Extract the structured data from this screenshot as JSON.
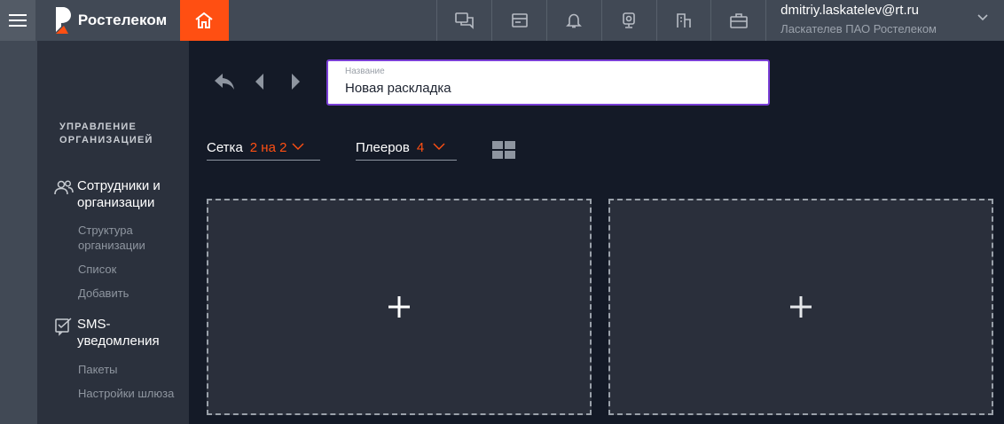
{
  "header": {
    "brand": "Ростелеком",
    "user_email": "dmitriy.laskatelev@rt.ru",
    "user_org": "Ласкателев ПАО Ростелеком",
    "icons": [
      "menu-icon",
      "home-icon",
      "chat-icon",
      "calendar-icon",
      "bell-icon",
      "camera-icon",
      "building-icon",
      "briefcase-icon",
      "chevron-down-icon"
    ],
    "accent_color": "#ff4f12"
  },
  "sidebar": {
    "section_title": "УПРАВЛЕНИЕ ОРГАНИЗАЦИЕЙ",
    "groups": [
      {
        "label": "Сотрудники и организации",
        "icon": "users-icon",
        "items": [
          "Структура организации",
          "Список",
          "Добавить"
        ]
      },
      {
        "label": "SMS-уведомления",
        "icon": "sms-check-icon",
        "items": [
          "Пакеты",
          "Настройки шлюза"
        ]
      }
    ]
  },
  "main": {
    "name_field": {
      "label": "Название",
      "value": "Новая раскладка"
    },
    "grid_select": {
      "label": "Сетка",
      "value": "2 на 2"
    },
    "players_select": {
      "label": "Плееров",
      "value": "4"
    },
    "slots": [
      "add-slot",
      "add-slot"
    ]
  }
}
